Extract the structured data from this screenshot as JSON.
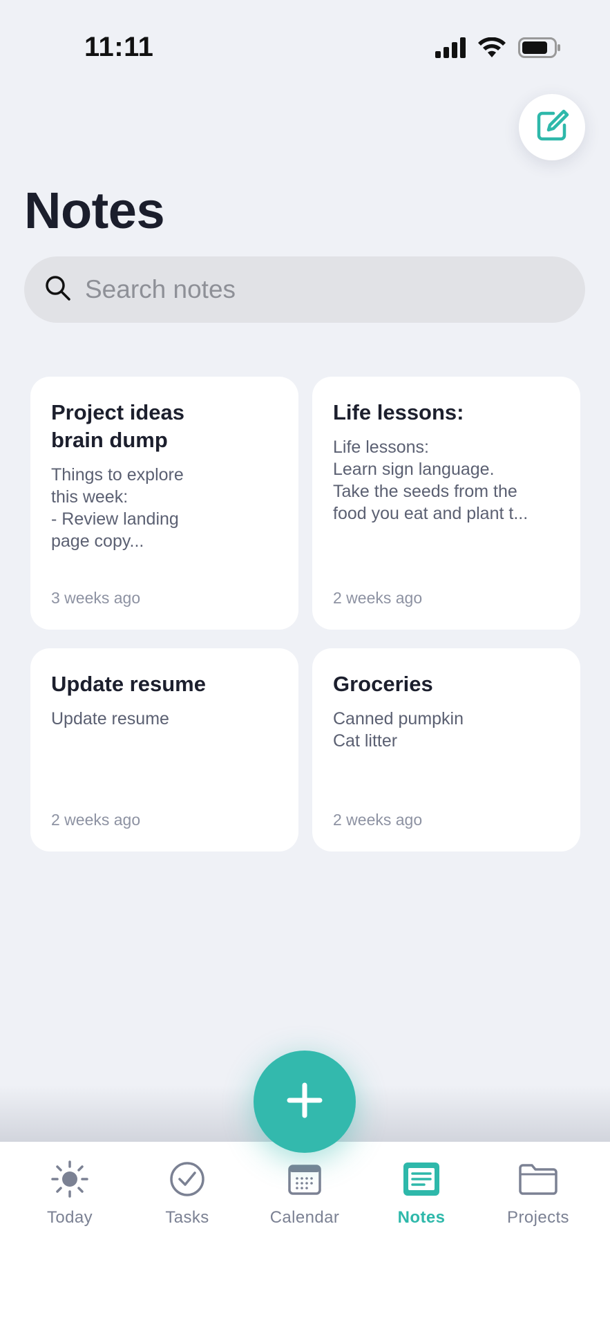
{
  "status_bar": {
    "time": "11:11"
  },
  "header": {
    "title": "Notes"
  },
  "search": {
    "placeholder": "Search notes",
    "value": ""
  },
  "notes": [
    {
      "title": "Project ideas brain dump",
      "body": "Things to explore\nthis week:\n- Review landing\npage copy...",
      "time": "3 weeks ago"
    },
    {
      "title": "Life lessons:",
      "body": "Life lessons:\nLearn sign language.\nTake the seeds from the\nfood you eat and plant t...",
      "time": "2 weeks ago"
    },
    {
      "title": "Update resume",
      "body": "Update resume",
      "time": "2 weeks ago"
    },
    {
      "title": "Groceries",
      "body": "Canned pumpkin\nCat litter",
      "time": "2 weeks ago"
    }
  ],
  "tabs": [
    {
      "label": "Today",
      "icon": "sun-icon",
      "active": false
    },
    {
      "label": "Tasks",
      "icon": "check-circle-icon",
      "active": false
    },
    {
      "label": "Calendar",
      "icon": "calendar-icon",
      "active": false
    },
    {
      "label": "Notes",
      "icon": "notes-icon",
      "active": true
    },
    {
      "label": "Projects",
      "icon": "folder-icon",
      "active": false
    }
  ],
  "colors": {
    "accent": "#33b9ad",
    "background": "#eff1f6",
    "card": "#ffffff",
    "inactive_tab": "#7b8193"
  }
}
